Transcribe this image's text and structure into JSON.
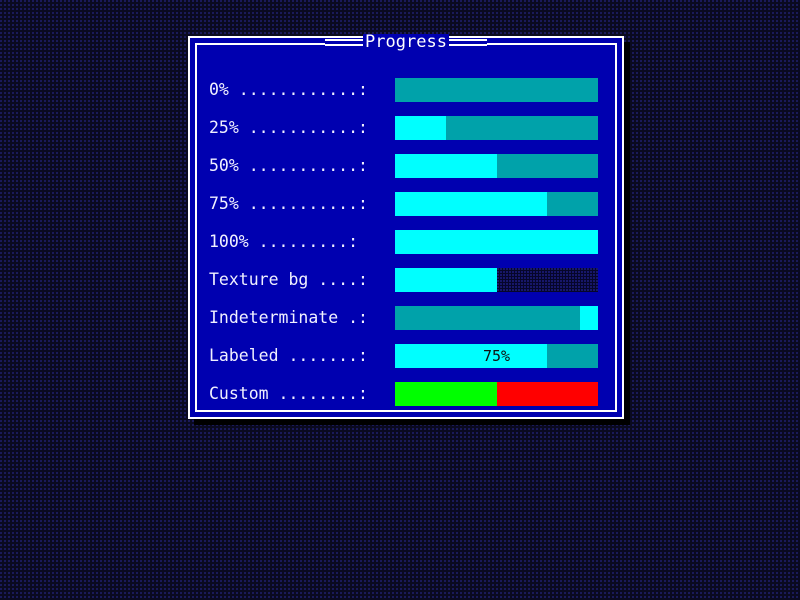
{
  "window": {
    "title": "Progress",
    "frame_color": "#0000b0",
    "border_color": "#ffffff",
    "shadow_color": "#000000"
  },
  "desktop": {
    "background_color": "#0a0a20",
    "pattern_dot_color": "#1b1b5e"
  },
  "palette": {
    "track_teal": "#00a2aa",
    "fill_cyan": "#00ffff",
    "fill_green": "#00ff00",
    "track_red": "#ff0000",
    "texture_base": "#06062a",
    "texture_dot": "#1b1b7a",
    "label_text": "#f0f0ff",
    "bar_text": "#101010"
  },
  "rows": [
    {
      "label": "0% ............:",
      "name": "progress-0",
      "percent": 0,
      "track": "teal",
      "fill": "cyan",
      "style": "determinate",
      "text": ""
    },
    {
      "label": "25% ...........:",
      "name": "progress-25",
      "percent": 25,
      "track": "teal",
      "fill": "cyan",
      "style": "determinate",
      "text": ""
    },
    {
      "label": "50% ...........:",
      "name": "progress-50",
      "percent": 50,
      "track": "teal",
      "fill": "cyan",
      "style": "determinate",
      "text": ""
    },
    {
      "label": "75% ...........:",
      "name": "progress-75",
      "percent": 75,
      "track": "teal",
      "fill": "cyan",
      "style": "determinate",
      "text": ""
    },
    {
      "label": "100% .........:",
      "name": "progress-100",
      "percent": 100,
      "track": "teal",
      "fill": "cyan",
      "style": "determinate",
      "text": ""
    },
    {
      "label": "Texture bg ....:",
      "name": "progress-texture-bg",
      "percent": 50,
      "track": "texture",
      "fill": "cyan",
      "style": "determinate",
      "text": ""
    },
    {
      "label": "Indeterminate .:",
      "name": "progress-indeterminate",
      "percent": 0,
      "track": "teal",
      "fill": "cyan",
      "style": "indeterminate",
      "chunk_start": 91,
      "chunk_width": 9,
      "text": ""
    },
    {
      "label": "Labeled .......:",
      "name": "progress-labeled",
      "percent": 75,
      "track": "teal",
      "fill": "cyan",
      "style": "labeled",
      "text": "75%"
    },
    {
      "label": "Custom ........:",
      "name": "progress-custom",
      "percent": 50,
      "track": "red",
      "fill": "green",
      "style": "determinate",
      "text": ""
    }
  ]
}
